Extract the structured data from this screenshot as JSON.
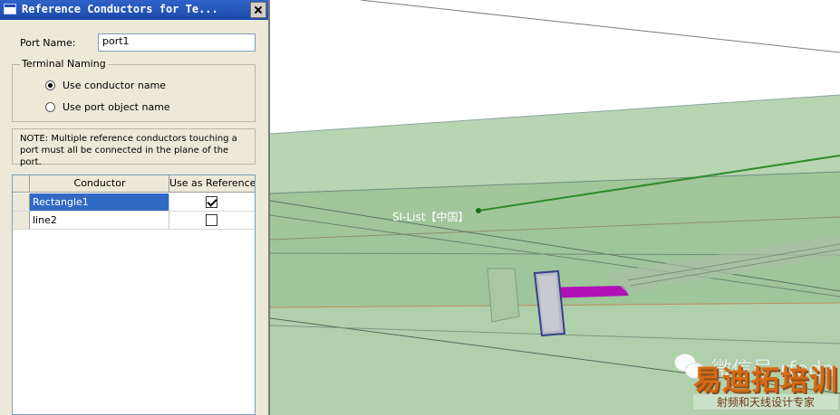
{
  "dialog": {
    "title": "Reference Conductors for Te...",
    "port_name_label": "Port Name:",
    "port_name_value": "port1",
    "terminal_naming_label": "Terminal Naming",
    "radio_conductor": "Use conductor name",
    "radio_port": "Use port object name",
    "note": "NOTE: Multiple reference conductors touching a port must all be connected in the plane of the port.",
    "table": {
      "headers": [
        "Conductor",
        "Use as Reference"
      ],
      "rows": [
        {
          "name": "Rectangle1",
          "use_as_reference": true,
          "selected": true
        },
        {
          "name": "line2",
          "use_as_reference": false,
          "selected": false
        }
      ]
    }
  },
  "viewport": {
    "label": "SI-List【中国】",
    "watermark": "微信号 rfeda",
    "brand": "易迪拓培训",
    "brand_sub": "射频和天线设计专家"
  },
  "colors": {
    "title_bar": "#1b49a9",
    "selection": "#316ac5",
    "board": "#a9cba3",
    "port": "#4d55a3",
    "trace": "#b012b6"
  }
}
